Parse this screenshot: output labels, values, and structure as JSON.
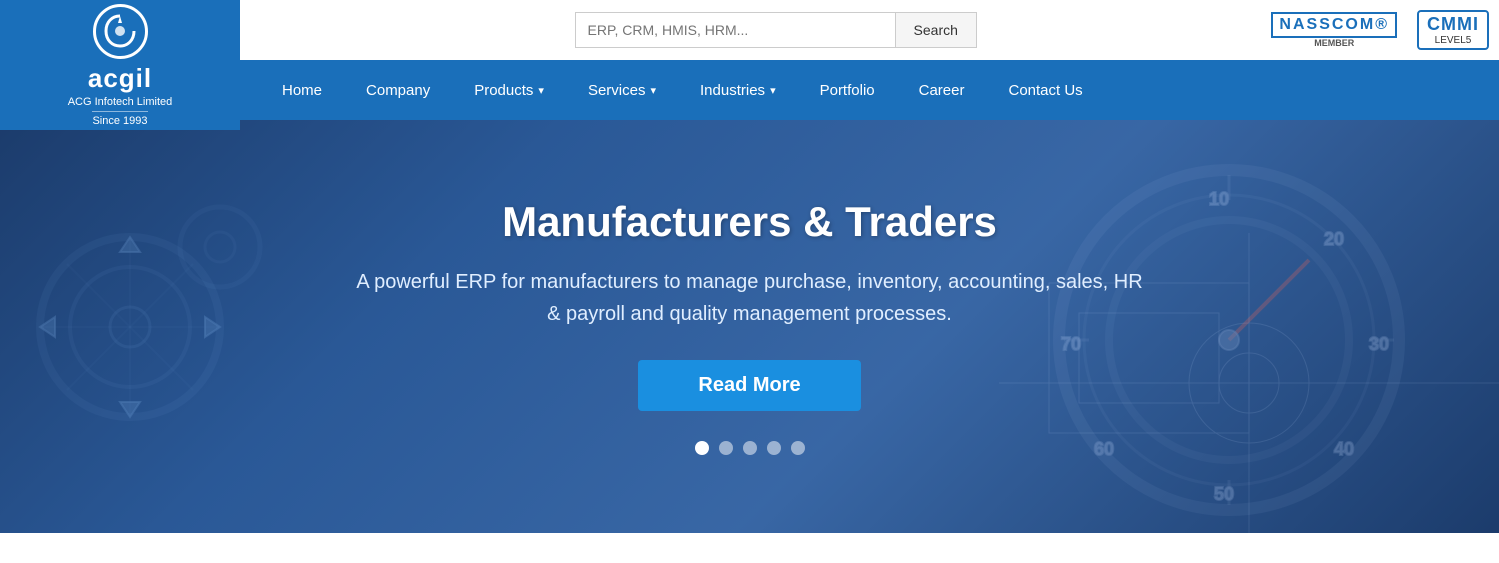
{
  "header": {
    "logo": {
      "letter": "G",
      "name": "acgil",
      "company": "ACG Infotech Limited",
      "since": "Since 1993"
    },
    "search": {
      "placeholder": "ERP, CRM, HMIS, HRM...",
      "button_label": "Search"
    },
    "badges": {
      "nasscom_label": "NASSCOM",
      "nasscom_sub": "MEMBER",
      "cmmi_label": "CMMI",
      "cmmi_level": "LEVEL5"
    }
  },
  "nav": {
    "items": [
      {
        "label": "Home",
        "has_dropdown": false
      },
      {
        "label": "Company",
        "has_dropdown": false
      },
      {
        "label": "Products",
        "has_dropdown": true
      },
      {
        "label": "Services",
        "has_dropdown": true
      },
      {
        "label": "Industries",
        "has_dropdown": true
      },
      {
        "label": "Portfolio",
        "has_dropdown": false
      },
      {
        "label": "Career",
        "has_dropdown": false
      },
      {
        "label": "Contact Us",
        "has_dropdown": false
      }
    ]
  },
  "hero": {
    "title": "Manufacturers & Traders",
    "description": "A powerful ERP for manufacturers to manage purchase, inventory, accounting, sales, HR & payroll and quality management processes.",
    "button_label": "Read More",
    "dots": [
      {
        "active": true
      },
      {
        "active": false
      },
      {
        "active": false
      },
      {
        "active": false
      },
      {
        "active": false
      }
    ]
  }
}
